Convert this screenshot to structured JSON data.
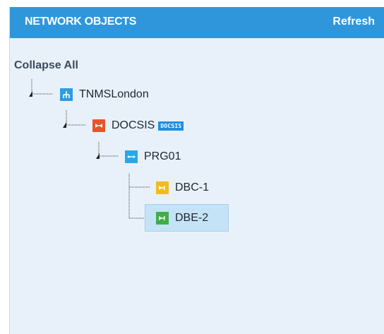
{
  "header": {
    "title": "NETWORK OBJECTS",
    "refresh_label": "Refresh",
    "color": "#2f96db"
  },
  "tree": {
    "collapse_all_label": "Collapse All",
    "nodes": [
      {
        "label": "TNMSLondon",
        "icon": "network-icon",
        "icon_color": "#2f9be0",
        "expanded": true
      },
      {
        "label": "DOCSIS",
        "badge": "DOCSIS",
        "icon": "docsis-icon",
        "icon_color": "#e8542c",
        "expanded": true
      },
      {
        "label": "PRG01",
        "icon": "link-icon",
        "icon_color": "#2aa8e6",
        "expanded": true
      },
      {
        "label": "DBC-1",
        "icon": "device-icon",
        "icon_color": "#f2bb1e"
      },
      {
        "label": "DBE-2",
        "icon": "device-icon",
        "icon_color": "#3fae49",
        "selected": true
      }
    ]
  }
}
